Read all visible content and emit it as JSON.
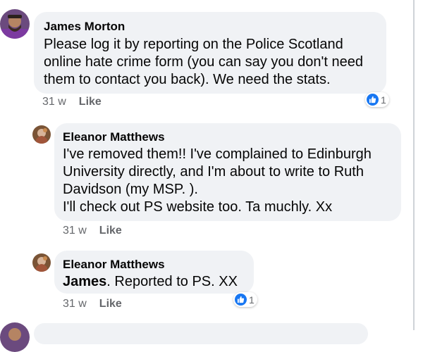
{
  "comments": [
    {
      "author": "James Morton",
      "text": "Please log it by reporting on the Police Scotland\nonline hate crime form (you can say you don't need\nthem to contact you back). We need the stats.",
      "time": "31 w",
      "like_label": "Like",
      "reaction_count": "1"
    },
    {
      "author": "Eleanor Matthews",
      "text": "I've removed them!!  I've complained to Edinburgh\nUniversity directly, and I'm about to write to Ruth\nDavidson (my MSP. ).\nI'll check out PS website too.  Ta muchly. Xx",
      "time": "31 w",
      "like_label": "Like"
    },
    {
      "author": "Eleanor Matthews",
      "mention": "James",
      "text": ".  Reported to PS. XX",
      "time": "31 w",
      "like_label": "Like",
      "reaction_count": "1"
    }
  ],
  "colors": {
    "bubble": "#f0f2f5",
    "meta_text": "#65676b",
    "like_blue": "#1877f2"
  },
  "icons": [
    "avatar",
    "thumbs-up-reaction-icon"
  ]
}
